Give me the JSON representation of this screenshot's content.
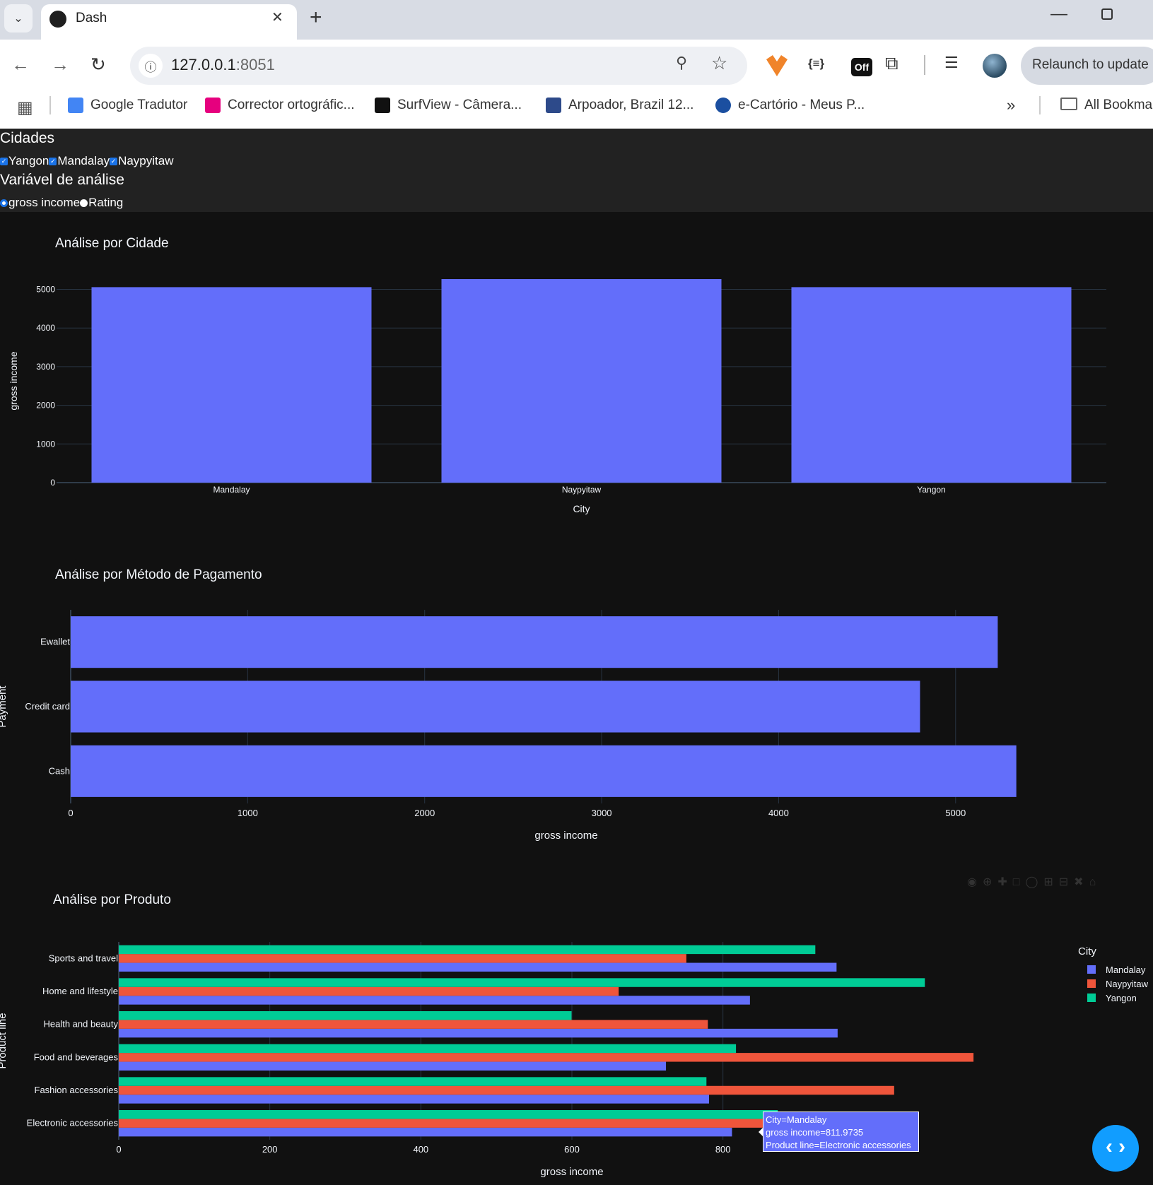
{
  "browser": {
    "tab_title": "Dash",
    "url_host": "127.0.0.1",
    "url_port": ":8051",
    "relaunch_label": "Relaunch to update",
    "ext_off_label": "Off",
    "ext_json_label": "{≡}",
    "bookmarks": [
      {
        "label": "Google Tradutor",
        "color": "#4285f4"
      },
      {
        "label": "Corrector ortográfic...",
        "color": "#e6007e"
      },
      {
        "label": "SurfView - Câmera...",
        "color": "#111111"
      },
      {
        "label": "Arpoador, Brazil 12...",
        "color": "#2d4a8a"
      },
      {
        "label": "e-Cartório - Meus P...",
        "color": "#1b4fa0"
      }
    ],
    "all_bookmarks_label": "All Bookma"
  },
  "controls": {
    "cidades_label": "Cidades",
    "cities": [
      "Yangon",
      "Mandalay",
      "Naypyitaw"
    ],
    "variavel_label": "Variável de análise",
    "variables": [
      "gross income",
      "Rating"
    ],
    "selected_variable": "gross income"
  },
  "chart_data": [
    {
      "type": "bar",
      "title": "Análise por Cidade",
      "categories": [
        "Mandalay",
        "Naypyitaw",
        "Yangon"
      ],
      "values": [
        5057,
        5265,
        5057
      ],
      "xlabel": "City",
      "ylabel": "gross income",
      "ylim": [
        0,
        5265
      ],
      "yticks": [
        0,
        1000,
        2000,
        3000,
        4000,
        5000
      ],
      "color": "#636efa",
      "grid": true
    },
    {
      "type": "bar",
      "orientation": "horizontal",
      "title": "Análise por Método de Pagamento",
      "categories": [
        "Cash",
        "Credit card",
        "Ewallet"
      ],
      "values": [
        5343,
        4799,
        5238
      ],
      "xlabel": "gross income",
      "ylabel": "Payment",
      "xlim": [
        0,
        5600
      ],
      "xticks": [
        0,
        1000,
        2000,
        3000,
        4000,
        5000
      ],
      "color": "#636efa",
      "grid": true
    },
    {
      "type": "bar",
      "orientation": "horizontal",
      "title": "Análise por Produto",
      "categories": [
        "Electronic accessories",
        "Fashion accessories",
        "Food and beverages",
        "Health and beauty",
        "Home and lifestyle",
        "Sports and travel"
      ],
      "series": [
        {
          "name": "Mandalay",
          "color": "#636efa",
          "values": [
            811.97,
            781.59,
            724.54,
            951.83,
            835.76,
            950.41
          ]
        },
        {
          "name": "Naypyitaw",
          "color": "#ef553b",
          "values": [
            903.32,
            1026.67,
            1131.76,
            780.01,
            661.93,
            751.55
          ]
        },
        {
          "name": "Yangon",
          "color": "#00cc96",
          "values": [
            872.61,
            778.13,
            817.25,
            599.51,
            1067.35,
            922.29
          ]
        }
      ],
      "xlabel": "gross income",
      "ylabel": "Product line",
      "legend_title": "City",
      "legend_position": "right",
      "xlim": [
        0,
        1200
      ],
      "xticks": [
        0,
        200,
        400,
        600,
        800
      ],
      "grid": true
    }
  ],
  "tooltip": {
    "line1": "City=Mandalay",
    "line2": "gross income=811.9735",
    "line3": "Product line=Electronic accessories"
  },
  "fab_label": "‹ ›"
}
